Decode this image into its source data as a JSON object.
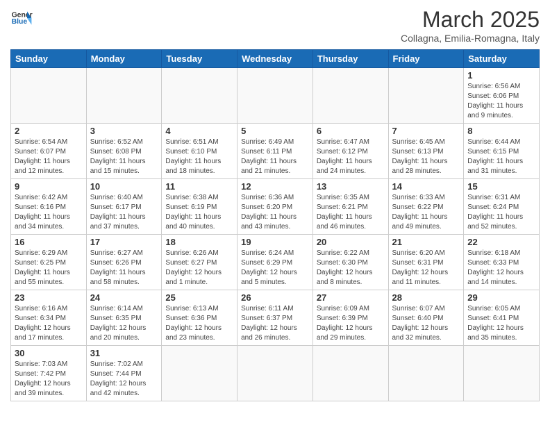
{
  "logo": {
    "text_general": "General",
    "text_blue": "Blue"
  },
  "title": "March 2025",
  "subtitle": "Collagna, Emilia-Romagna, Italy",
  "days_of_week": [
    "Sunday",
    "Monday",
    "Tuesday",
    "Wednesday",
    "Thursday",
    "Friday",
    "Saturday"
  ],
  "weeks": [
    [
      {
        "day": "",
        "info": ""
      },
      {
        "day": "",
        "info": ""
      },
      {
        "day": "",
        "info": ""
      },
      {
        "day": "",
        "info": ""
      },
      {
        "day": "",
        "info": ""
      },
      {
        "day": "",
        "info": ""
      },
      {
        "day": "1",
        "info": "Sunrise: 6:56 AM\nSunset: 6:06 PM\nDaylight: 11 hours and 9 minutes."
      }
    ],
    [
      {
        "day": "2",
        "info": "Sunrise: 6:54 AM\nSunset: 6:07 PM\nDaylight: 11 hours and 12 minutes."
      },
      {
        "day": "3",
        "info": "Sunrise: 6:52 AM\nSunset: 6:08 PM\nDaylight: 11 hours and 15 minutes."
      },
      {
        "day": "4",
        "info": "Sunrise: 6:51 AM\nSunset: 6:10 PM\nDaylight: 11 hours and 18 minutes."
      },
      {
        "day": "5",
        "info": "Sunrise: 6:49 AM\nSunset: 6:11 PM\nDaylight: 11 hours and 21 minutes."
      },
      {
        "day": "6",
        "info": "Sunrise: 6:47 AM\nSunset: 6:12 PM\nDaylight: 11 hours and 24 minutes."
      },
      {
        "day": "7",
        "info": "Sunrise: 6:45 AM\nSunset: 6:13 PM\nDaylight: 11 hours and 28 minutes."
      },
      {
        "day": "8",
        "info": "Sunrise: 6:44 AM\nSunset: 6:15 PM\nDaylight: 11 hours and 31 minutes."
      }
    ],
    [
      {
        "day": "9",
        "info": "Sunrise: 6:42 AM\nSunset: 6:16 PM\nDaylight: 11 hours and 34 minutes."
      },
      {
        "day": "10",
        "info": "Sunrise: 6:40 AM\nSunset: 6:17 PM\nDaylight: 11 hours and 37 minutes."
      },
      {
        "day": "11",
        "info": "Sunrise: 6:38 AM\nSunset: 6:19 PM\nDaylight: 11 hours and 40 minutes."
      },
      {
        "day": "12",
        "info": "Sunrise: 6:36 AM\nSunset: 6:20 PM\nDaylight: 11 hours and 43 minutes."
      },
      {
        "day": "13",
        "info": "Sunrise: 6:35 AM\nSunset: 6:21 PM\nDaylight: 11 hours and 46 minutes."
      },
      {
        "day": "14",
        "info": "Sunrise: 6:33 AM\nSunset: 6:22 PM\nDaylight: 11 hours and 49 minutes."
      },
      {
        "day": "15",
        "info": "Sunrise: 6:31 AM\nSunset: 6:24 PM\nDaylight: 11 hours and 52 minutes."
      }
    ],
    [
      {
        "day": "16",
        "info": "Sunrise: 6:29 AM\nSunset: 6:25 PM\nDaylight: 11 hours and 55 minutes."
      },
      {
        "day": "17",
        "info": "Sunrise: 6:27 AM\nSunset: 6:26 PM\nDaylight: 11 hours and 58 minutes."
      },
      {
        "day": "18",
        "info": "Sunrise: 6:26 AM\nSunset: 6:27 PM\nDaylight: 12 hours and 1 minute."
      },
      {
        "day": "19",
        "info": "Sunrise: 6:24 AM\nSunset: 6:29 PM\nDaylight: 12 hours and 5 minutes."
      },
      {
        "day": "20",
        "info": "Sunrise: 6:22 AM\nSunset: 6:30 PM\nDaylight: 12 hours and 8 minutes."
      },
      {
        "day": "21",
        "info": "Sunrise: 6:20 AM\nSunset: 6:31 PM\nDaylight: 12 hours and 11 minutes."
      },
      {
        "day": "22",
        "info": "Sunrise: 6:18 AM\nSunset: 6:33 PM\nDaylight: 12 hours and 14 minutes."
      }
    ],
    [
      {
        "day": "23",
        "info": "Sunrise: 6:16 AM\nSunset: 6:34 PM\nDaylight: 12 hours and 17 minutes."
      },
      {
        "day": "24",
        "info": "Sunrise: 6:14 AM\nSunset: 6:35 PM\nDaylight: 12 hours and 20 minutes."
      },
      {
        "day": "25",
        "info": "Sunrise: 6:13 AM\nSunset: 6:36 PM\nDaylight: 12 hours and 23 minutes."
      },
      {
        "day": "26",
        "info": "Sunrise: 6:11 AM\nSunset: 6:37 PM\nDaylight: 12 hours and 26 minutes."
      },
      {
        "day": "27",
        "info": "Sunrise: 6:09 AM\nSunset: 6:39 PM\nDaylight: 12 hours and 29 minutes."
      },
      {
        "day": "28",
        "info": "Sunrise: 6:07 AM\nSunset: 6:40 PM\nDaylight: 12 hours and 32 minutes."
      },
      {
        "day": "29",
        "info": "Sunrise: 6:05 AM\nSunset: 6:41 PM\nDaylight: 12 hours and 35 minutes."
      }
    ],
    [
      {
        "day": "30",
        "info": "Sunrise: 7:03 AM\nSunset: 7:42 PM\nDaylight: 12 hours and 39 minutes."
      },
      {
        "day": "31",
        "info": "Sunrise: 7:02 AM\nSunset: 7:44 PM\nDaylight: 12 hours and 42 minutes."
      },
      {
        "day": "",
        "info": ""
      },
      {
        "day": "",
        "info": ""
      },
      {
        "day": "",
        "info": ""
      },
      {
        "day": "",
        "info": ""
      },
      {
        "day": "",
        "info": ""
      }
    ]
  ]
}
